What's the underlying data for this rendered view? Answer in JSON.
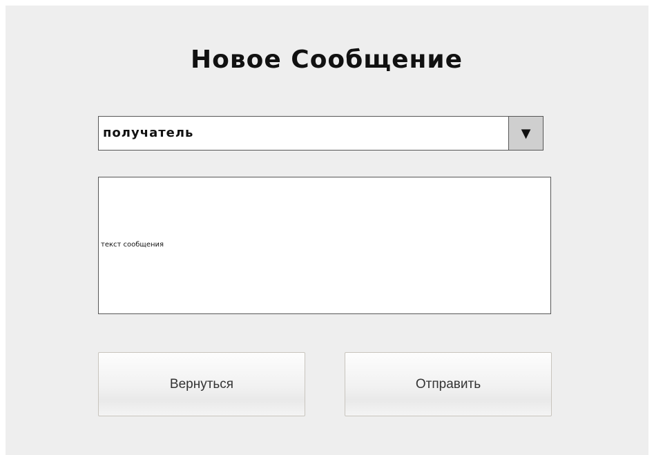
{
  "form": {
    "title": "Новое Сообщение",
    "recipient": {
      "value": "получатель",
      "arrow_glyph": "▼"
    },
    "message": {
      "placeholder": "текст сообщения"
    },
    "buttons": {
      "back_label": "Вернуться",
      "send_label": "Отправить"
    }
  }
}
